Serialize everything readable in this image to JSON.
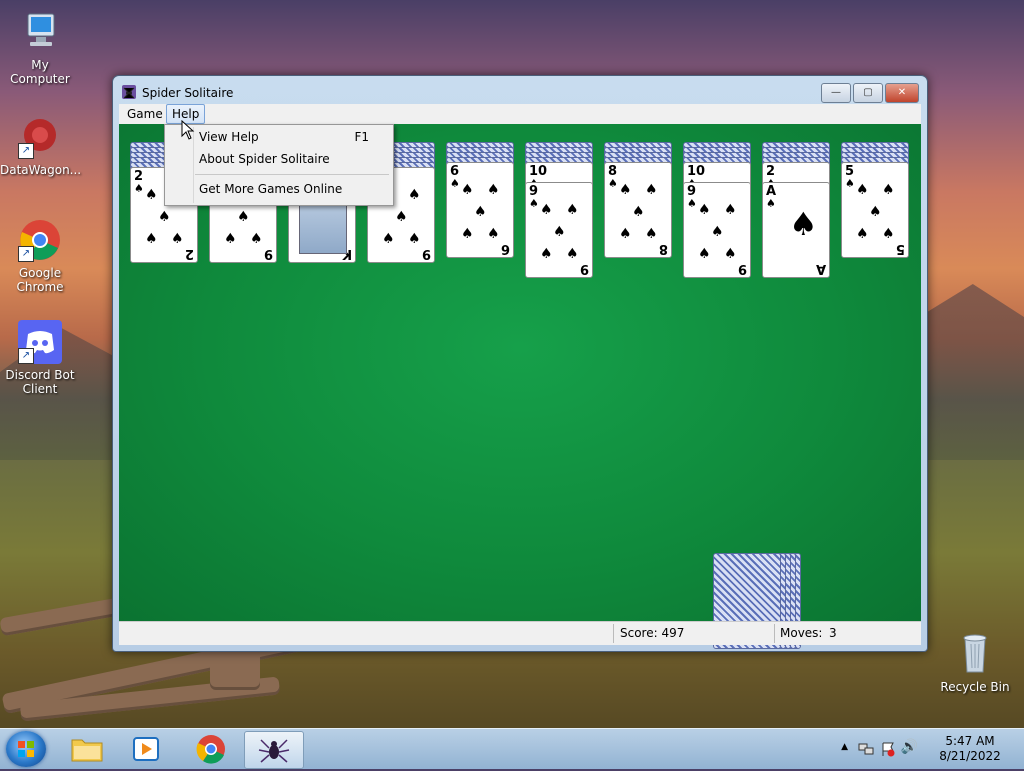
{
  "desktop": {
    "icons": [
      {
        "label": "My Computer"
      },
      {
        "label": "DataWagon..."
      },
      {
        "label": "Google Chrome"
      },
      {
        "label": "Discord Bot Client"
      },
      {
        "label": "Recycle Bin"
      }
    ]
  },
  "window": {
    "title": "Spider Solitaire",
    "controls": {
      "minimize": "—",
      "maximize": "▢",
      "close": "✕"
    }
  },
  "menubar": {
    "items": [
      {
        "label": "Game"
      },
      {
        "label": "Help"
      }
    ]
  },
  "help_menu": {
    "items": [
      {
        "label": "View Help",
        "shortcut": "F1"
      },
      {
        "label": "About Spider Solitaire",
        "shortcut": ""
      },
      {
        "label": "Get More Games Online",
        "shortcut": ""
      }
    ]
  },
  "tableau": {
    "columns": [
      {
        "top_rank": "2",
        "face_up": [
          "2"
        ]
      },
      {
        "top_rank": "9",
        "face_up": [
          "9"
        ]
      },
      {
        "top_rank": "K",
        "face_up": [
          "K"
        ]
      },
      {
        "top_rank": "9",
        "face_up": [
          "9"
        ]
      },
      {
        "top_rank": "6",
        "face_up": [
          "6"
        ]
      },
      {
        "top_rank": "9",
        "face_up": [
          "10",
          "9"
        ]
      },
      {
        "top_rank": "8",
        "face_up": [
          "8"
        ]
      },
      {
        "top_rank": "9",
        "face_up": [
          "10",
          "9"
        ]
      },
      {
        "top_rank": "A",
        "face_up": [
          "2",
          "A"
        ]
      },
      {
        "top_rank": "5",
        "face_up": [
          "5"
        ]
      }
    ],
    "suit_symbol": "♠"
  },
  "statusbar": {
    "score": "Score: 497",
    "moves_label": "Moves:",
    "moves_value": "3"
  },
  "taskbar": {
    "time": "5:47 AM",
    "date": "8/21/2022"
  }
}
